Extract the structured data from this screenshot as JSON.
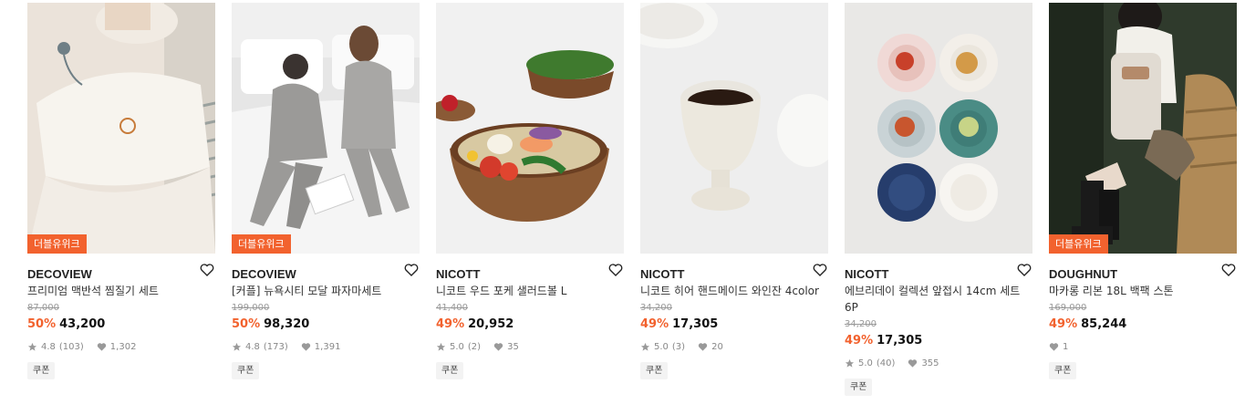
{
  "products": [
    {
      "badge": "더블유위크",
      "brand": "DECOVIEW",
      "title": "프리미엄 맥반석 찜질기 세트",
      "original_price": "87,000",
      "discount": "50%",
      "price": "43,200",
      "rating": "4.8",
      "reviews": "(103)",
      "likes": "1,302",
      "coupon": "쿠폰",
      "image_icon": "blanket-photo"
    },
    {
      "badge": "더블유위크",
      "brand": "DECOVIEW",
      "title": "[커플] 뉴욕시티 모달 파자마세트",
      "original_price": "199,000",
      "discount": "50%",
      "price": "98,320",
      "rating": "4.8",
      "reviews": "(173)",
      "likes": "1,391",
      "coupon": "쿠폰",
      "image_icon": "pajama-couple-photo"
    },
    {
      "badge": "",
      "brand": "NICOTT",
      "title": "니코트 우드 포케 샐러드볼 L",
      "original_price": "41,400",
      "discount": "49%",
      "price": "20,952",
      "rating": "5.0",
      "reviews": "(2)",
      "likes": "35",
      "coupon": "쿠폰",
      "image_icon": "salad-bowl-photo"
    },
    {
      "badge": "",
      "brand": "NICOTT",
      "title": "니코트 히어 핸드메이드 와인잔 4color",
      "original_price": "34,200",
      "discount": "49%",
      "price": "17,305",
      "rating": "5.0",
      "reviews": "(3)",
      "likes": "20",
      "coupon": "쿠폰",
      "image_icon": "wine-cup-photo"
    },
    {
      "badge": "",
      "brand": "NICOTT",
      "title": "에브리데이 컬렉션 앞접시 14cm 세트 6P",
      "original_price": "34,200",
      "discount": "49%",
      "price": "17,305",
      "rating": "5.0",
      "reviews": "(40)",
      "likes": "355",
      "coupon": "쿠폰",
      "image_icon": "plates-photo"
    },
    {
      "badge": "더블유위크",
      "brand": "DOUGHNUT",
      "title": "마카롱 리본 18L 백팩 스톤",
      "original_price": "169,000",
      "discount": "49%",
      "price": "85,244",
      "rating": "",
      "reviews": "",
      "likes": "1",
      "coupon": "쿠폰",
      "image_icon": "backpack-photo"
    }
  ],
  "colors": {
    "accent": "#f2622e",
    "text": "#222222",
    "muted": "#999999"
  }
}
